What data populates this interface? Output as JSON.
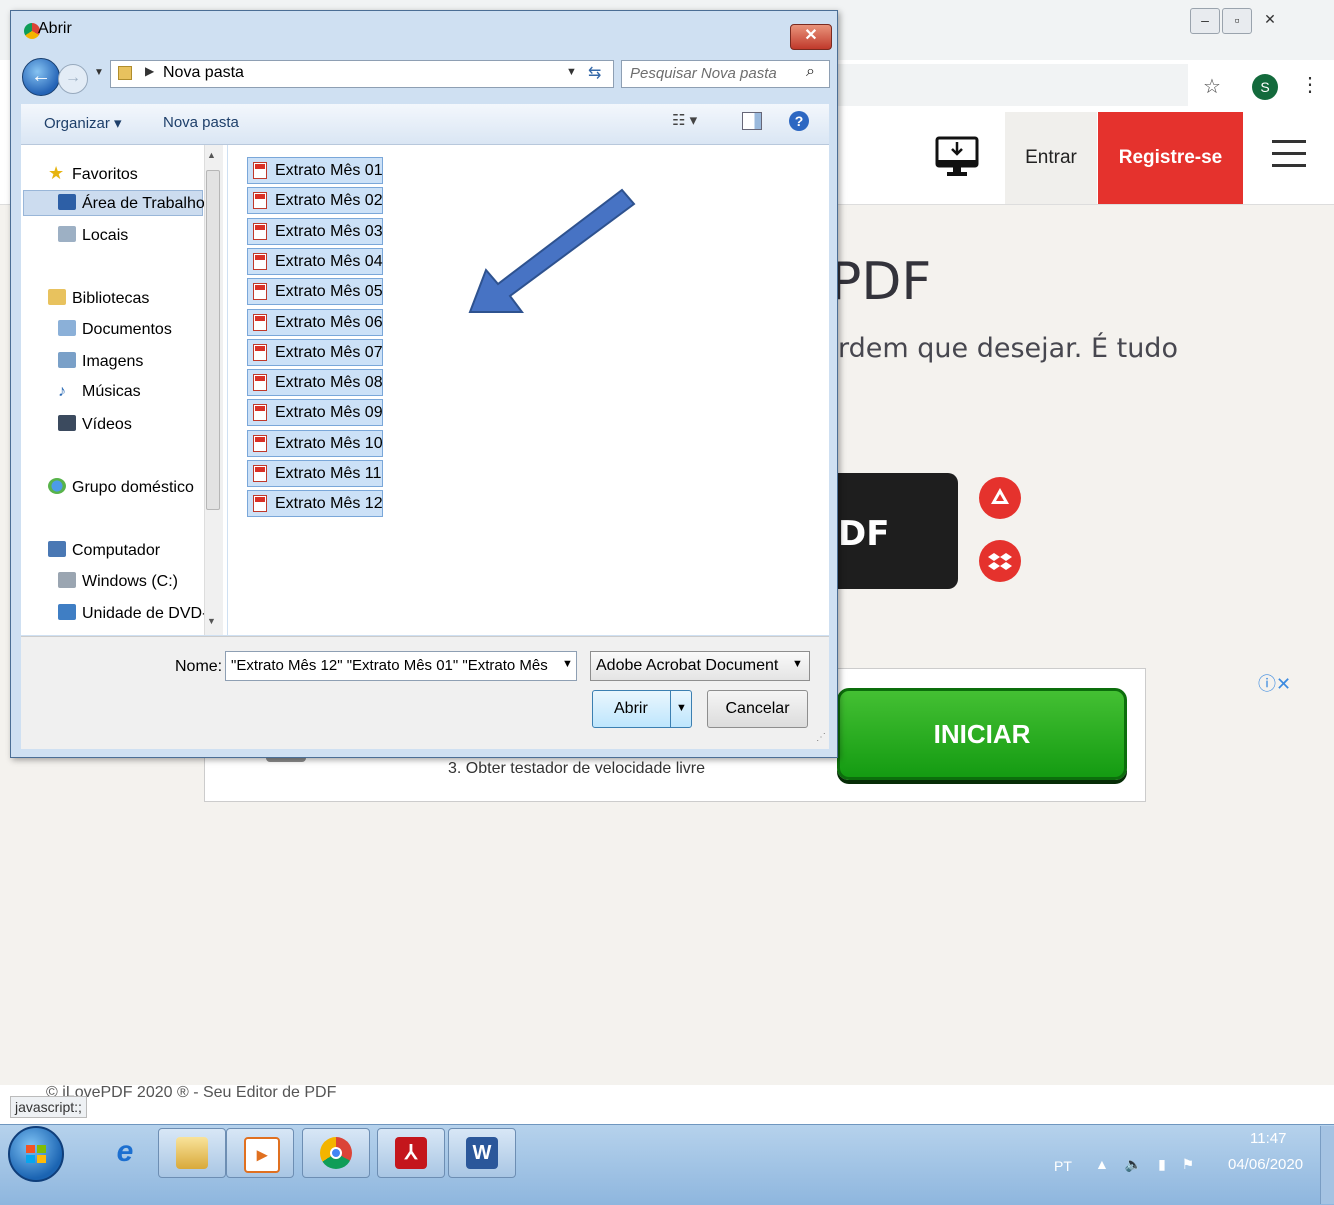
{
  "browser": {
    "profile_initial": "S",
    "win_controls": [
      "–",
      "▫",
      "✕"
    ],
    "star_icon": "☆",
    "menu_icon": "⋮"
  },
  "site": {
    "nav_login": "Entrar",
    "nav_signup": "Registre-se",
    "hero_title_fragment": "PDF",
    "hero_subtitle_fragment": "rdem que desejar. É tudo",
    "select_button_fragment": "DF",
    "footer": "© iLovePDF 2020 ® - Seu Editor de PDF",
    "status_url": "javascript:;",
    "accent": "#e5322d"
  },
  "ad": {
    "text": "3. Obter testador de velocidade livre",
    "button": "INICIAR",
    "info": "ⓘ✕"
  },
  "dialog": {
    "title": "Abrir",
    "close_icon": "✕",
    "breadcrumb": "Nova pasta",
    "search_placeholder": "Pesquisar Nova pasta",
    "toolbar": {
      "organize": "Organizar ▾",
      "new_folder": "Nova pasta",
      "views_icon": "☷ ▾",
      "help_icon": "?"
    },
    "nav": {
      "favorites": "Favoritos",
      "desktop": "Área de Trabalho",
      "places": "Locais",
      "libraries": "Bibliotecas",
      "documents": "Documentos",
      "images": "Imagens",
      "music": "Músicas",
      "videos": "Vídeos",
      "homegroup": "Grupo doméstico",
      "computer": "Computador",
      "drive_c": "Windows (C:)",
      "dvd": "Unidade de DVD-"
    },
    "files": [
      "Extrato Mês 01",
      "Extrato Mês 02",
      "Extrato Mês 03",
      "Extrato Mês 04",
      "Extrato Mês 05",
      "Extrato Mês 06",
      "Extrato Mês 07",
      "Extrato Mês 08",
      "Extrato Mês 09",
      "Extrato Mês 10",
      "Extrato Mês 11",
      "Extrato Mês 12"
    ],
    "filename_label": "Nome:",
    "filename_value": "\"Extrato Mês 12\" \"Extrato Mês 01\" \"Extrato Mês",
    "filetype": "Adobe Acrobat Document",
    "open_label": "Abrir",
    "cancel_label": "Cancelar"
  },
  "taskbar": {
    "lang": "PT",
    "tray_icons": "▲ 🔈 ▮ ⚑",
    "time": "11:47",
    "date": "04/06/2020",
    "apps": [
      "internet-explorer",
      "file-explorer",
      "media-player",
      "chrome",
      "adobe-acrobat",
      "word"
    ]
  }
}
